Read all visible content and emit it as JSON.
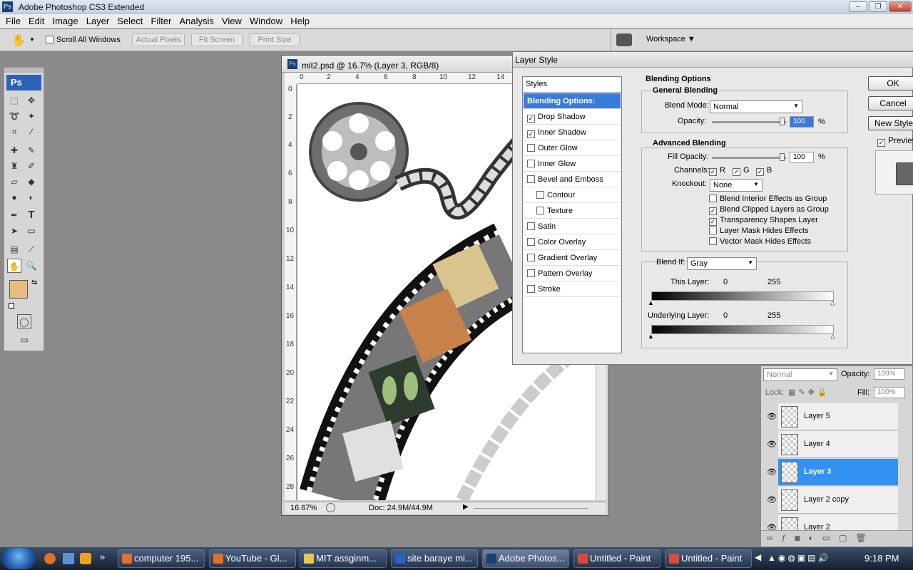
{
  "app": {
    "title": "Adobe Photoshop CS3 Extended",
    "ps_badge": "Ps"
  },
  "menu": [
    "File",
    "Edit",
    "Image",
    "Layer",
    "Select",
    "Filter",
    "Analysis",
    "View",
    "Window",
    "Help"
  ],
  "options": {
    "scroll_all": "Scroll All Windows",
    "actual_pixels": "Actual Pixels",
    "fit_screen": "Fit Screen",
    "print_size": "Print Size",
    "workspace": "Workspace"
  },
  "toolbox": {
    "logo": "Ps"
  },
  "document": {
    "title": "mit2.psd @ 16.7% (Layer 3, RGB/8)",
    "zoom": "16.67%",
    "doc_size": "Doc: 24.9M/44.9M",
    "ruler_h": [
      "0",
      "2",
      "4",
      "6",
      "8",
      "10",
      "12",
      "14"
    ],
    "ruler_v": [
      "0",
      "2",
      "4",
      "6",
      "8",
      "10",
      "12",
      "14",
      "16",
      "18",
      "20",
      "22",
      "24",
      "26",
      "28"
    ]
  },
  "dialog": {
    "title": "Layer Style",
    "styles_header": "Styles",
    "styles": [
      {
        "label": "Blending Options: Default",
        "checkbox": false,
        "selected": true
      },
      {
        "label": "Drop Shadow",
        "checkbox": true,
        "checked": true
      },
      {
        "label": "Inner Shadow",
        "checkbox": true,
        "checked": true
      },
      {
        "label": "Outer Glow",
        "checkbox": true,
        "checked": false
      },
      {
        "label": "Inner Glow",
        "checkbox": true,
        "checked": false
      },
      {
        "label": "Bevel and Emboss",
        "checkbox": true,
        "checked": false
      },
      {
        "label": "Contour",
        "checkbox": true,
        "checked": false,
        "indent": true
      },
      {
        "label": "Texture",
        "checkbox": true,
        "checked": false,
        "indent": true
      },
      {
        "label": "Satin",
        "checkbox": true,
        "checked": false
      },
      {
        "label": "Color Overlay",
        "checkbox": true,
        "checked": false
      },
      {
        "label": "Gradient Overlay",
        "checkbox": true,
        "checked": false
      },
      {
        "label": "Pattern Overlay",
        "checkbox": true,
        "checked": false
      },
      {
        "label": "Stroke",
        "checkbox": true,
        "checked": false
      }
    ],
    "blending_options": "Blending Options",
    "general_blending": "General Blending",
    "blend_mode_label": "Blend Mode:",
    "blend_mode": "Normal",
    "opacity_label": "Opacity:",
    "opacity": "100",
    "pct": "%",
    "advanced_blending": "Advanced Blending",
    "fill_opacity_label": "Fill Opacity:",
    "fill_opacity": "100",
    "channels_label": "Channels:",
    "ch_r": "R",
    "ch_g": "G",
    "ch_b": "B",
    "knockout_label": "Knockout:",
    "knockout": "None",
    "adv_checks": [
      {
        "label": "Blend Interior Effects as Group",
        "checked": false
      },
      {
        "label": "Blend Clipped Layers as Group",
        "checked": true
      },
      {
        "label": "Transparency Shapes Layer",
        "checked": true
      },
      {
        "label": "Layer Mask Hides Effects",
        "checked": false
      },
      {
        "label": "Vector Mask Hides Effects",
        "checked": false
      }
    ],
    "blend_if_label": "Blend If:",
    "blend_if": "Gray",
    "this_layer_label": "This Layer:",
    "this_layer_min": "0",
    "this_layer_max": "255",
    "underlying_label": "Underlying Layer:",
    "underlying_min": "0",
    "underlying_max": "255",
    "ok": "OK",
    "cancel": "Cancel",
    "new_style": "New Style...",
    "preview": "Preview"
  },
  "layers": {
    "blend": "Normal",
    "opacity_label": "Opacity:",
    "opacity": "100%",
    "lock_label": "Lock:",
    "fill_label": "Fill:",
    "fill": "100%",
    "rows": [
      {
        "name": "Layer 5",
        "selected": false
      },
      {
        "name": "Layer 4",
        "selected": false
      },
      {
        "name": "Layer 3",
        "selected": true
      },
      {
        "name": "Layer 2 copy",
        "selected": false
      },
      {
        "name": "Layer 2",
        "selected": false
      }
    ]
  },
  "taskbar": {
    "items": [
      {
        "label": "computer 195...",
        "color": "#e0702a"
      },
      {
        "label": "YouTube - Gl...",
        "color": "#e0702a"
      },
      {
        "label": "MIT  assginm...",
        "color": "#e8c64a"
      },
      {
        "label": "site baraye mi...",
        "color": "#2a62c4"
      },
      {
        "label": "Adobe Photos...",
        "color": "#1b3f73",
        "active": true
      },
      {
        "label": "Untitled - Paint",
        "color": "#d84a3a"
      },
      {
        "label": "Untitled - Paint",
        "color": "#d84a3a"
      }
    ],
    "clock": "9:18 PM"
  }
}
